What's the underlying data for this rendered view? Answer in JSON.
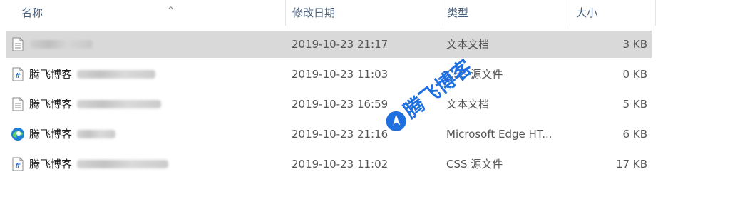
{
  "header": {
    "col_name": "名称",
    "col_date": "修改日期",
    "col_type": "类型",
    "col_size": "大小",
    "sort_arrow": "^"
  },
  "rows": [
    {
      "name": "",
      "date": "2019-10-23 21:17",
      "type": "文本文档",
      "size": "3 KB",
      "icon": "text-file-icon",
      "selected": true
    },
    {
      "name": "腾飞博客",
      "date": "2019-10-23 11:03",
      "type": "CSS 源文件",
      "size": "0 KB",
      "icon": "css-file-icon"
    },
    {
      "name": "腾飞博客",
      "date": "2019-10-23 16:59",
      "type": "文本文档",
      "size": "5 KB",
      "icon": "text-file-icon"
    },
    {
      "name": "腾飞博客",
      "date": "2019-10-23 21:16",
      "type": "Microsoft Edge HT...",
      "size": "6 KB",
      "icon": "edge-icon"
    },
    {
      "name": "腾飞博客",
      "date": "2019-10-23 11:02",
      "type": "CSS 源文件",
      "size": "17 KB",
      "icon": "css-file-icon"
    }
  ],
  "watermark": {
    "text": "腾飞博客"
  },
  "colors": {
    "selected_row": "#d9d9d9",
    "header_text": "#4a5f7a",
    "watermark_blue": "#1e6fe0"
  }
}
